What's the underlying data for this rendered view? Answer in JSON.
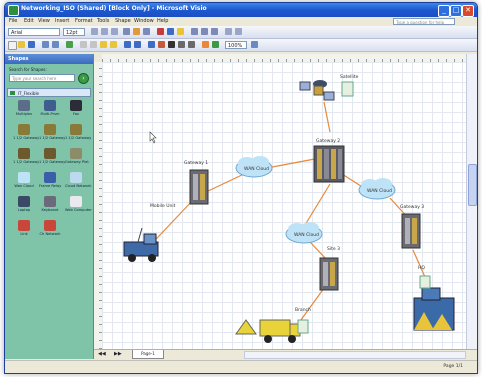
{
  "window": {
    "title": "Networking_ISO (Shared) [Block Only] - Microsoft Visio",
    "minimize": "_",
    "maximize": "□",
    "close": "✕"
  },
  "menu": [
    "File",
    "Edit",
    "View",
    "Insert",
    "Format",
    "Tools",
    "Shape",
    "Window",
    "Help"
  ],
  "ask_placeholder": "Type a question for help",
  "toolbar": {
    "font": "Arial",
    "font_size": "12pt",
    "zoom": "100%"
  },
  "shapes_panel": {
    "title": "Shapes",
    "search_label": "Search for Shapes:",
    "search_placeholder": "Type your search here",
    "stencil": "IT_Flexible",
    "items": [
      {
        "label": "Multiplex",
        "icon": "multiplexer-icon",
        "color": "#5a6e8a"
      },
      {
        "label": "Multi-Prsm",
        "icon": "multiplexer-icon",
        "color": "#3f5e8f"
      },
      {
        "label": "Fax",
        "icon": "fax-icon",
        "color": "#2c2c38"
      },
      {
        "label": "1 1/2 Gateway",
        "icon": "gateway-icon",
        "color": "#8a7a3a"
      },
      {
        "label": "1 1/2 Gateway",
        "icon": "gateway-icon",
        "color": "#8a7a3a"
      },
      {
        "label": "1 1/2 Gateway",
        "icon": "gateway-icon",
        "color": "#8a7a3a"
      },
      {
        "label": "1 1/2 Gateway",
        "icon": "gateway-icon",
        "color": "#6c5a2e"
      },
      {
        "label": "1 1/2 Gateway",
        "icon": "gateway-icon",
        "color": "#6c5a2e"
      },
      {
        "label": "Gateway Plat",
        "icon": "gateway-icon",
        "color": "#8c8c6a"
      },
      {
        "label": "Wan Cloud",
        "icon": "cloud-icon",
        "color": "#bfe3f6"
      },
      {
        "label": "Frame Relay",
        "icon": "frame-relay-icon",
        "color": "#3a5fa8"
      },
      {
        "label": "Cloud Network",
        "icon": "cloud-network-icon",
        "color": "#bdd9ef"
      },
      {
        "label": "Laptop",
        "icon": "laptop-icon",
        "color": "#3a4a66"
      },
      {
        "label": "Keyboard",
        "icon": "keyboard-icon",
        "color": "#6a6a7a"
      },
      {
        "label": "Web Computer",
        "icon": "computer-icon",
        "color": "#e9e9ef"
      },
      {
        "label": "Link",
        "icon": "link-icon",
        "color": "#c8463a"
      },
      {
        "label": "Ch Network",
        "icon": "network-link-icon",
        "color": "#c8463a"
      }
    ]
  },
  "canvas": {
    "labels": {
      "satellite": "Satellite",
      "gateway1": "Gateway 1",
      "gateway2": "Gateway 2",
      "gateway3": "Gateway 3",
      "mobile": "Mobile Unit",
      "hq": "HQ",
      "site3": "Site 3",
      "branch": "Branch",
      "cloud1": "WAN Cloud",
      "cloud2": "WAN Cloud",
      "cloud3": "WAN Cloud"
    }
  },
  "page_tab": "Page-1",
  "status": {
    "page": "Page 1/1"
  },
  "colors": {
    "titlebar": "#1d58d0",
    "shapes_panel": "#7fc4a8",
    "connector": "#e8883a",
    "cloud": "#bfe3f6"
  }
}
